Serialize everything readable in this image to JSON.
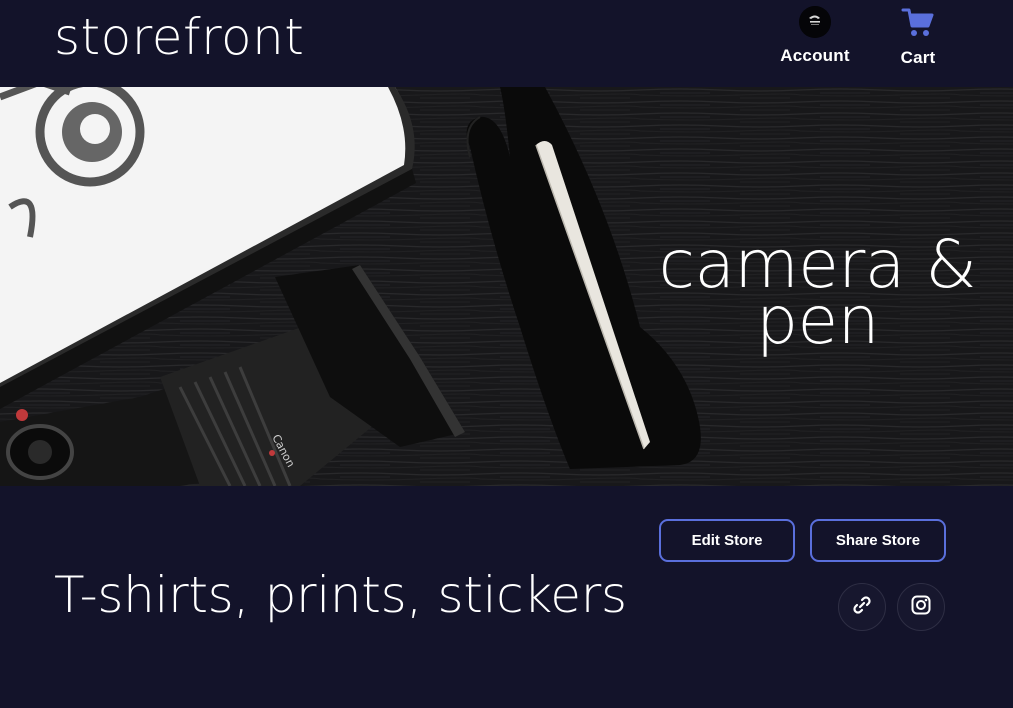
{
  "header": {
    "brand": "storefront",
    "account_label": "Account",
    "cart_label": "Cart",
    "accent_color": "#5a6fdc"
  },
  "banner": {
    "title": "camera &\npen"
  },
  "actions": {
    "edit_label": "Edit Store",
    "share_label": "Share Store"
  },
  "store": {
    "tagline": "T-shirts, prints, stickers"
  },
  "social": {
    "icons": [
      "link-icon",
      "instagram-icon"
    ]
  },
  "colors": {
    "background": "#13132a",
    "button_border": "#5a6fdc"
  }
}
